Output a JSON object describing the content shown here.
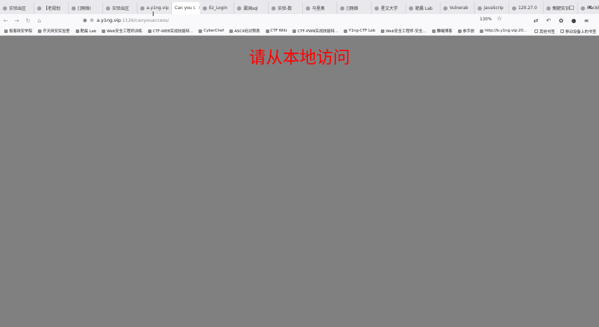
{
  "tabs": [
    {
      "label": "实验出区",
      "active": false
    },
    {
      "label": "【老规划",
      "active": false
    },
    {
      "label": "[]网络(",
      "active": false
    },
    {
      "label": "实验出区",
      "active": false
    },
    {
      "label": "a.y1ng.vip",
      "active": false
    },
    {
      "label": "Can you c",
      "active": true
    },
    {
      "label": "Ez_Login",
      "active": false
    },
    {
      "label": "漏洞sql",
      "active": false
    },
    {
      "label": "实验-数",
      "active": false
    },
    {
      "label": "马里奥",
      "active": false
    },
    {
      "label": "[]网络",
      "active": false
    },
    {
      "label": "星文大学",
      "active": false
    },
    {
      "label": "靶晨 Lab",
      "active": false
    },
    {
      "label": "Vulnerab",
      "active": false
    },
    {
      "label": "JavaScrip",
      "active": false
    },
    {
      "label": "120.27.0",
      "active": false
    },
    {
      "label": "期靶实训",
      "active": false
    },
    {
      "label": "HackBar",
      "active": false
    }
  ],
  "tab_close": "×",
  "new_tab": "+",
  "window": {
    "minimize": "–",
    "maximize": "▢",
    "close": "✕"
  },
  "nav": {
    "back": "←",
    "forward": "→",
    "reload": "↻",
    "home": "⌂"
  },
  "url": {
    "host": "a.y1ng.vip",
    "path": ":1126/canyouaccess/"
  },
  "zoom": "130%",
  "bookmark_star": "☆",
  "bookmarks": [
    "极客网安学院",
    "齐天网安实验室",
    "靶晨 Lab",
    "Web安全工程师训练",
    "CTF-WEB实战技能特...",
    "CyberChef",
    "ASCII码对照表",
    "CTF Wiki",
    "CTF-PWN实战技能特...",
    "Y1ng-CTF Lab",
    "Web安全工程师-安全...",
    "舞曦博客",
    "参手册",
    "http://b.y1ng.vip:20..."
  ],
  "bookmarks_right": [
    "其他书签",
    "移动设备上的书签"
  ],
  "page": {
    "notice": "请从本地访问"
  },
  "colors": {
    "page_bg": "#808080",
    "notice": "#ff0000",
    "toolbar_bg": "#f9f9fb",
    "tabstrip_bg": "#e9e9ed"
  }
}
